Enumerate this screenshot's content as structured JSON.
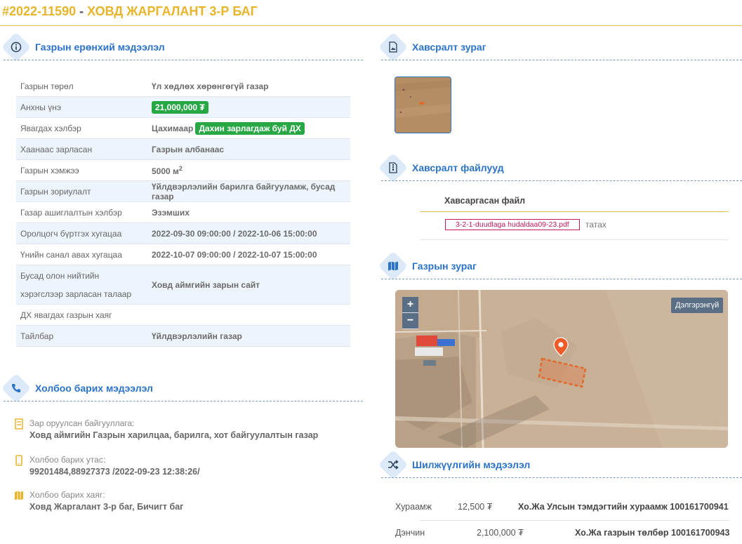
{
  "header": {
    "code": "#2022-11590",
    "separator": " - ",
    "title": "ХОВД ЖАРГАЛАНТ 3-Р БАГ"
  },
  "sections": {
    "general": "Газрын ерөнхий мэдээлэл",
    "contact": "Холбоо барих мэдээлэл",
    "photo": "Хавсралт зураг",
    "files": "Хавсралт файлууд",
    "map": "Газрын зураг",
    "transfer": "Шилжүүлгийн мэдээлэл"
  },
  "info_rows": [
    {
      "label": "Газрын төрөл",
      "value": "Үл хөдлөх хөрөнгөгүй газар"
    },
    {
      "label": "Анхны үнэ",
      "value": "21,000,000 ₮"
    },
    {
      "label": "Явагдах хэлбэр",
      "value": "Цахимаар",
      "badge": "Дахин зарлагдаж буй ДХ"
    },
    {
      "label": "Хаанаас зарласан",
      "value": "Газрын албанаас"
    },
    {
      "label": "Газрын хэмжээ",
      "value": "5000 м",
      "sup": "2"
    },
    {
      "label": "Газрын зориулалт",
      "value": "Үйлдвэрлэлийн барилга байгууламж, бусад газар"
    },
    {
      "label": "Газар ашиглалтын хэлбэр",
      "value": "Эзэмших"
    },
    {
      "label": "Оролцогч бүртгэх хугацаа",
      "value": "2022-09-30 09:00:00 / 2022-10-06 15:00:00"
    },
    {
      "label": "Үнийн санал авах хугацаа",
      "value": "2022-10-07 09:00:00 / 2022-10-07 15:00:00"
    },
    {
      "label": "Бусад олон нийтийн хэрэгслээр зарласан талаар",
      "value": "Ховд аймгийн зарын сайт"
    },
    {
      "label": "ДХ явагдах газрын хаяг",
      "value": ""
    },
    {
      "label": "Тайлбар",
      "value": "Үйлдвэрлэлийн газар"
    }
  ],
  "contact": {
    "org_label": "Зар оруулсан байгууллага:",
    "org_value": "Ховд аймгийн Газрын харилцаа, барилга, хот байгуулалтын газар",
    "phone_label": "Холбоо барих утас:",
    "phone_value": "99201484,88927373 /2022-09-23 12:38:26/",
    "address_label": "Холбоо барих хаяг:",
    "address_value": "Ховд Жаргалант 3-р баг, Бичигт баг"
  },
  "files": {
    "column": "Хавсаргасан файл",
    "file_name": "3-2-1-duudlaga hudaldaa09-23.pdf",
    "download": "татах"
  },
  "map": {
    "zoom_in": "+",
    "zoom_out": "−",
    "more": "Дэлгэрэнгүй"
  },
  "transfer_rows": [
    {
      "type": "Хураамж",
      "amount": "12,500 ₮",
      "desc": "Хо.Жа Улсын тэмдэгтийн хураамж 100161700941"
    },
    {
      "type": "Дэнчин",
      "amount": "2,100,000 ₮",
      "desc": "Хо.Жа газрын төлбөр 100161700943"
    }
  ],
  "colors": {
    "accent": "#2b73c7",
    "header": "#e7b52b",
    "badge": "#28a745",
    "file_link": "#c2185b"
  }
}
